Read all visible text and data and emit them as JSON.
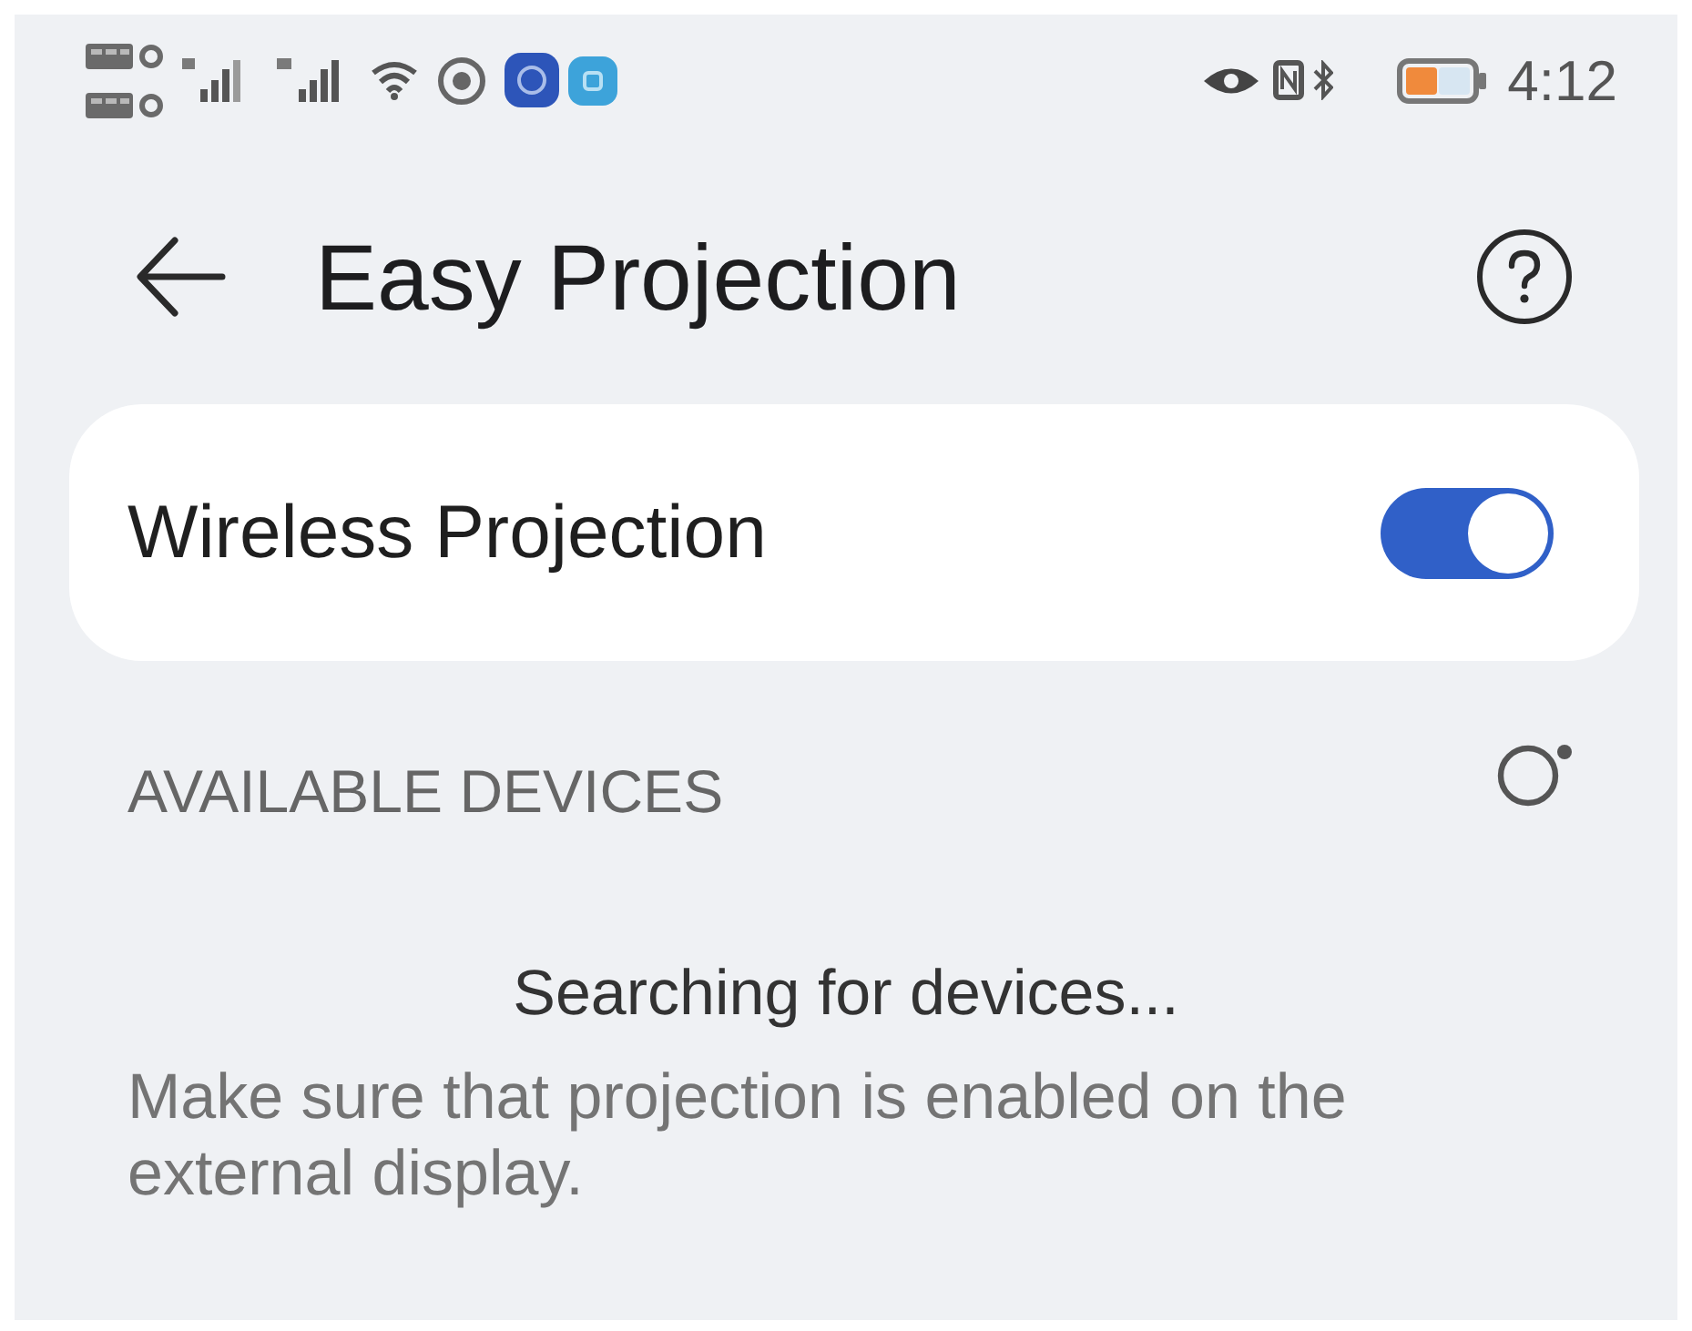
{
  "status_bar": {
    "time": "4:12"
  },
  "header": {
    "title": "Easy Projection"
  },
  "settings": [
    {
      "kind": "toggle",
      "label": "Wireless Projection",
      "on": true
    }
  ],
  "available_devices": {
    "heading": "AVAILABLE DEVICES",
    "status": "Searching for devices...",
    "hint": "Make sure that projection is enabled on the external display."
  }
}
